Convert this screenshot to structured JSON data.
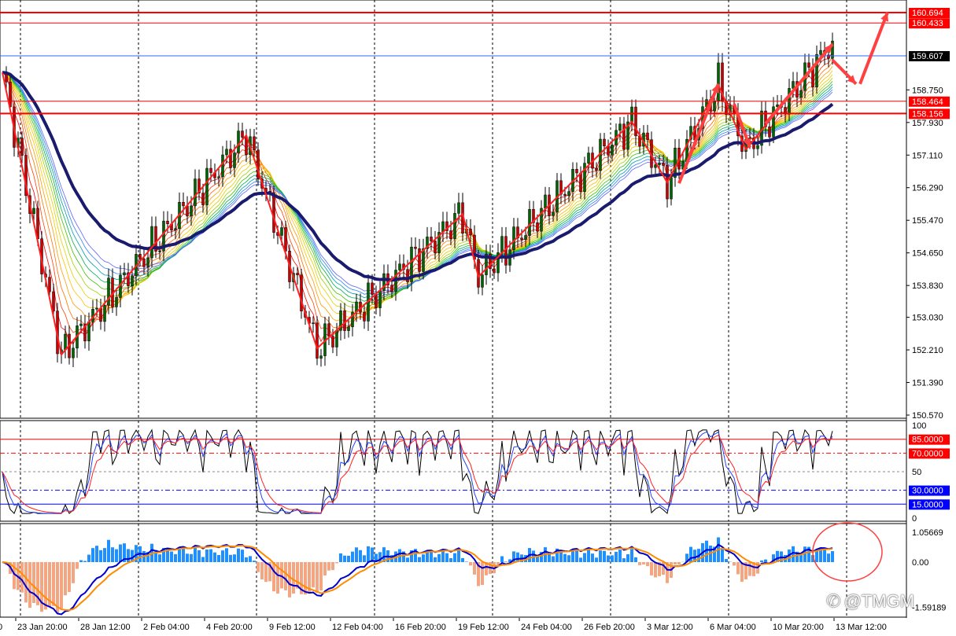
{
  "chart_data": {
    "type": "candlestick",
    "title": "",
    "price_axis": {
      "min": 150.57,
      "max": 160.694,
      "ticks": [
        "158.750",
        "157.930",
        "157.110",
        "156.290",
        "155.470",
        "154.650",
        "153.830",
        "153.030",
        "152.210",
        "151.390",
        "150.570"
      ]
    },
    "time_labels": [
      "0",
      "23 Jan 20:00",
      "28 Jan 12:00",
      "2 Feb 04:00",
      "4 Feb 20:00",
      "9 Feb 12:00",
      "12 Feb 04:00",
      "16 Feb 20:00",
      "19 Feb 12:00",
      "24 Feb 04:00",
      "26 Feb 20:00",
      "3 Mar 12:00",
      "6 Mar 04:00",
      "10 Mar 20:00",
      "13 Mar 12:00"
    ],
    "zigzag": [
      [
        0,
        159.19
      ],
      [
        15,
        152.09
      ],
      [
        62,
        157.61
      ],
      [
        80,
        152.25
      ],
      [
        117,
        155.63
      ],
      [
        121,
        154.05
      ],
      [
        160,
        157.95
      ],
      [
        169,
        156.42
      ],
      [
        182,
        158.88
      ],
      [
        189,
        157.25
      ],
      [
        211,
        159.92
      ]
    ],
    "projection": [
      [
        211,
        159.92
      ],
      [
        217,
        158.93
      ],
      [
        225,
        160.71
      ]
    ],
    "levels": [
      {
        "price": 160.694,
        "label": "160.694",
        "color": "#ff0000",
        "thick": true
      },
      {
        "price": 160.433,
        "label": "160.433",
        "color": "#ff0000",
        "thick": false
      },
      {
        "price": 159.607,
        "label": "159.607",
        "color": "#3366ff",
        "thick": false,
        "tag": "#000000"
      },
      {
        "price": 158.464,
        "label": "158.464",
        "color": "#ff0000",
        "thick": false
      },
      {
        "price": 158.156,
        "label": "158.156",
        "color": "#ff0000",
        "thick": true
      }
    ],
    "oscillator": {
      "max_label": "100",
      "mid_label": "50",
      "min_label": "0",
      "levels": [
        {
          "value": 85,
          "label": "85.0000",
          "color": "#ff0000"
        },
        {
          "value": 70,
          "label": "70.0000",
          "color": "#ff0000"
        },
        {
          "value": 30,
          "label": "30.0000",
          "color": "#0000ff"
        },
        {
          "value": 15,
          "label": "15.0000",
          "color": "#0000ff"
        }
      ]
    },
    "macd": {
      "max": 1.05669,
      "min": -1.59189,
      "labels": [
        "1.05669",
        "0.00",
        "-1.59189"
      ]
    }
  },
  "colors": {
    "up": "#006400",
    "down": "#cc0000",
    "ma_main": "#1a1a6e",
    "zigzag": "#ff2020",
    "hist_pos": "#1e90ff",
    "hist_neg": "#f4a582",
    "macd": "#0000cc",
    "signal": "#ff8c00"
  },
  "watermark": "@TMGM"
}
